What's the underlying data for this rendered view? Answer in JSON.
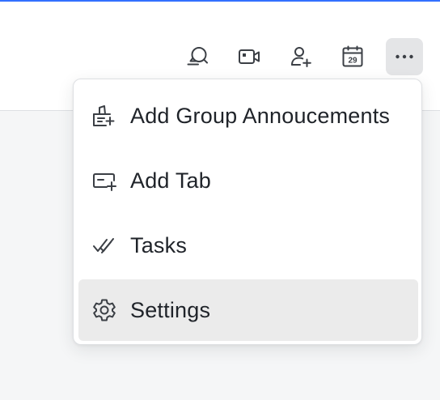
{
  "toolbar": {
    "buttons": [
      {
        "name": "search-chat",
        "icon": "search-message-icon"
      },
      {
        "name": "video-call",
        "icon": "video-camera-icon"
      },
      {
        "name": "add-member",
        "icon": "add-user-icon"
      },
      {
        "name": "calendar",
        "icon": "calendar-icon",
        "day": "29"
      },
      {
        "name": "more",
        "icon": "more-dots-icon",
        "active": true
      }
    ]
  },
  "menu": {
    "items": [
      {
        "label": "Add Group Annoucements",
        "icon": "announcement-icon"
      },
      {
        "label": "Add Tab",
        "icon": "add-tab-icon"
      },
      {
        "label": "Tasks",
        "icon": "tasks-check-icon"
      },
      {
        "label": "Settings",
        "icon": "gear-icon",
        "hovered": true
      }
    ]
  },
  "colors": {
    "accent": "#3370ff",
    "icon": "#3b3f45",
    "text": "#1f2329",
    "hover": "#ebebeb",
    "active_button": "#e4e5e7"
  }
}
